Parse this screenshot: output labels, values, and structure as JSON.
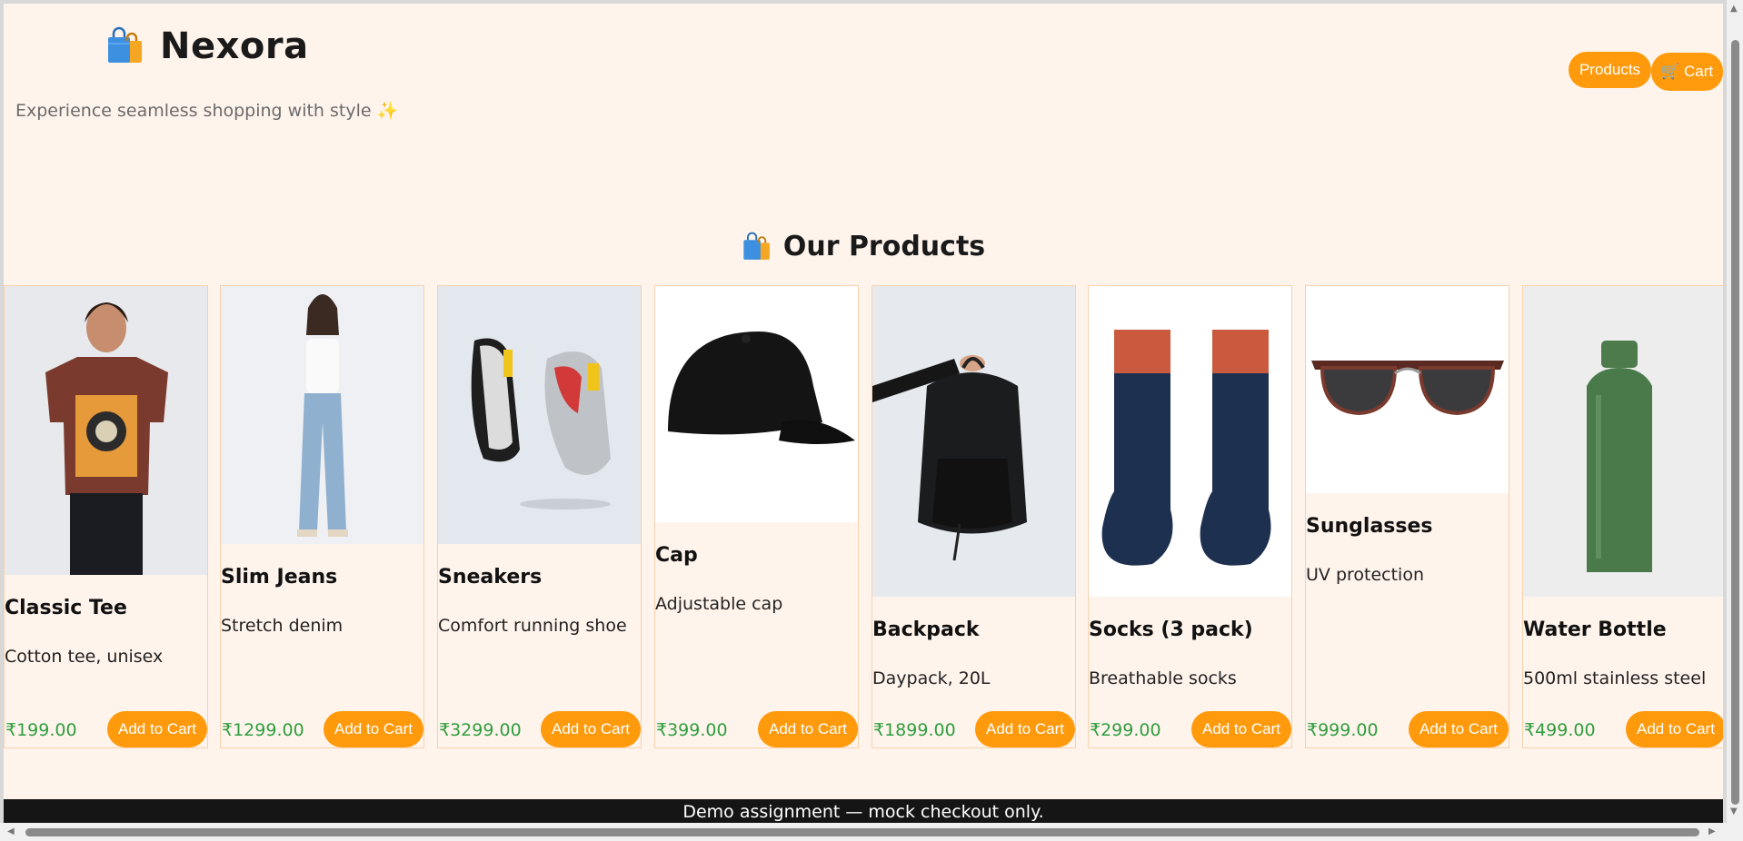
{
  "header": {
    "brand_name": "Nexora",
    "tagline": "Experience seamless shopping with style",
    "tagline_icon": "sparkle-icon",
    "nav": {
      "products_label": "Products",
      "cart_label": "Cart",
      "cart_icon": "cart-icon"
    }
  },
  "main": {
    "section_title": "Our Products",
    "add_label": "Add to Cart",
    "products": [
      {
        "name": "Classic Tee",
        "desc": "Cotton tee, unisex",
        "price": "₹199.00"
      },
      {
        "name": "Slim Jeans",
        "desc": "Stretch denim",
        "price": "₹1299.00"
      },
      {
        "name": "Sneakers",
        "desc": "Comfort running shoe",
        "price": "₹3299.00"
      },
      {
        "name": "Cap",
        "desc": "Adjustable cap",
        "price": "₹399.00"
      },
      {
        "name": "Backpack",
        "desc": "Daypack, 20L",
        "price": "₹1899.00"
      },
      {
        "name": "Socks (3 pack)",
        "desc": "Breathable socks",
        "price": "₹299.00"
      },
      {
        "name": "Sunglasses",
        "desc": "UV protection",
        "price": "₹999.00"
      },
      {
        "name": "Water Bottle",
        "desc": "500ml stainless steel",
        "price": "₹499.00"
      }
    ]
  },
  "footer": {
    "text": "Demo assignment — mock checkout only."
  },
  "colors": {
    "accent": "#ff9a0d",
    "background": "#fff4ec",
    "price": "#2e9e3e",
    "footer": "#151515"
  }
}
